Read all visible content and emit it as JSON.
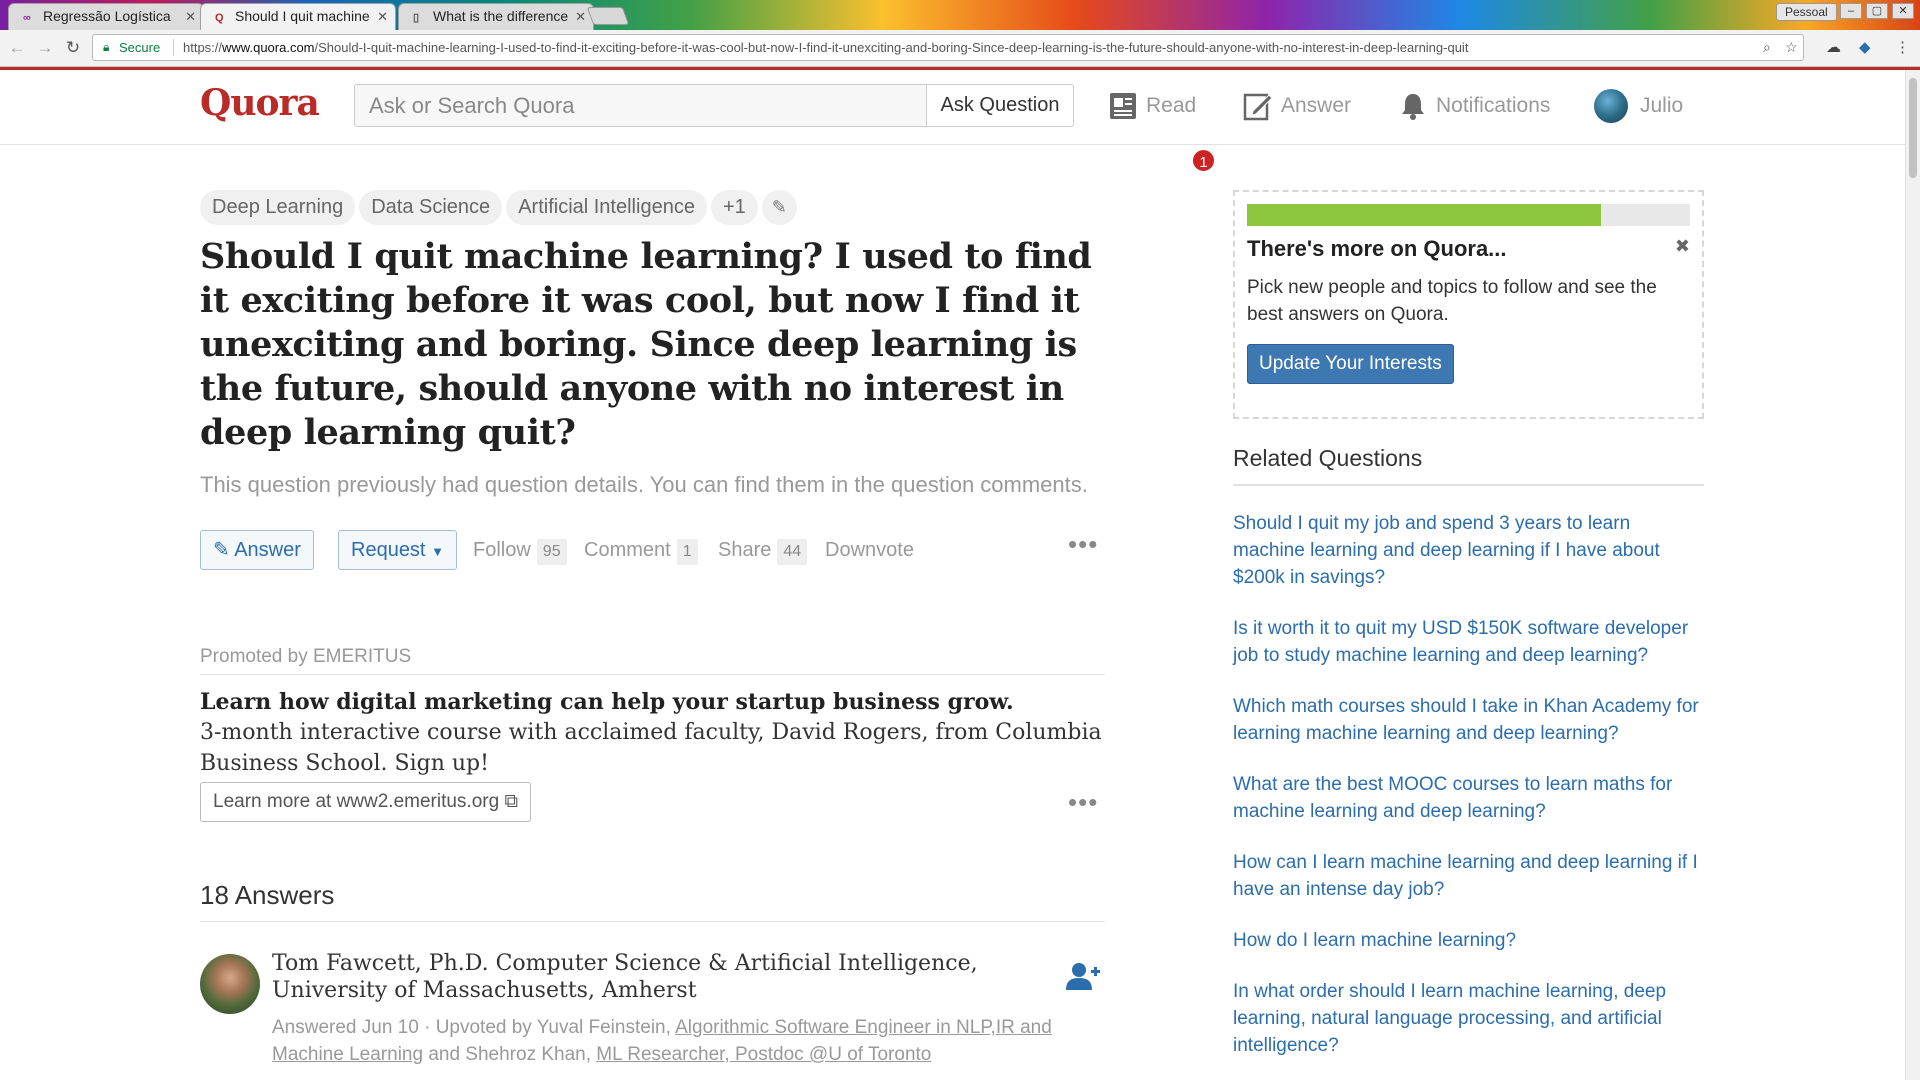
{
  "browser": {
    "tabs": [
      {
        "icon": "∞",
        "title": "Regressão Logística",
        "active": false
      },
      {
        "icon": "Q",
        "title": "Should I quit machine",
        "active": true
      },
      {
        "icon": "▯",
        "title": "What is the difference",
        "active": false
      }
    ],
    "profile": "Pessoal",
    "secure_label": "Secure",
    "url_scheme": "https://",
    "url_host": "www.quora.com",
    "url_path": "/Should-I-quit-machine-learning-I-used-to-find-it-exciting-before-it-was-cool-but-now-I-find-it-unexciting-and-boring-Since-deep-learning-is-the-future-should-anyone-with-no-interest-in-deep-learning-quit"
  },
  "header": {
    "logo": "Quora",
    "search_placeholder": "Ask or Search Quora",
    "ask_button": "Ask Question",
    "nav": {
      "read": "Read",
      "read_badge": "1",
      "answer": "Answer",
      "notifications": "Notifications",
      "user": "Julio"
    }
  },
  "question": {
    "topics": [
      "Deep Learning",
      "Data Science",
      "Artificial Intelligence",
      "+1"
    ],
    "title": "Should I quit machine learning? I used to find it exciting before it was cool, but now I find it unexciting and boring. Since deep learning is the future, should anyone with no interest in deep learning quit?",
    "note": "This question previously had question details. You can find them in the question comments.",
    "actions": {
      "answer": "Answer",
      "request": "Request",
      "follow": "Follow",
      "follow_count": "95",
      "comment": "Comment",
      "comment_count": "1",
      "share": "Share",
      "share_count": "44",
      "downvote": "Downvote"
    }
  },
  "promo": {
    "promoted_by": "Promoted by EMERITUS",
    "headline": "Learn how digital marketing can help your startup business grow.",
    "body": "3-month interactive course with acclaimed faculty, David Rogers, from Columbia Business School. Sign up!",
    "link": "Learn more at www2.emeritus.org"
  },
  "answers": {
    "heading": "18 Answers",
    "first": {
      "author": "Tom Fawcett, Ph.D. Computer Science & Artificial Intelligence, University of Massachusetts, Amherst",
      "answered": "Answered Jun 10 · Upvoted by Yuval Feinstein, ",
      "upvoter1_cred": "Algorithmic Software Engineer in NLP,IR and Machine Learning",
      "and_text": " and Shehroz Khan, ",
      "upvoter2_cred": "ML Researcher, Postdoc @U of Toronto"
    }
  },
  "sidebar": {
    "progress": 0.8,
    "more_title": "There's more on Quora...",
    "more_text": "Pick new people and topics to follow and see the best answers on Quora.",
    "update_button": "Update Your Interests",
    "related_heading": "Related Questions",
    "related": [
      "Should I quit my job and spend 3 years to learn machine learning and deep learning if I have about $200k in savings?",
      "Is it worth it to quit my USD $150K software developer job to study machine learning and deep learning?",
      "Which math courses should I take in Khan Academy for learning machine learning and deep learning?",
      "What are the best MOOC courses to learn maths for machine learning and deep learning?",
      "How can I learn machine learning and deep learning if I have an intense day job?",
      "How do I learn machine learning?",
      "In what order should I learn machine learning, deep learning, natural language processing, and artificial intelligence?"
    ]
  },
  "colors": {
    "brand": "#b92b27",
    "link": "#2b6dad",
    "progress": "#8cc63f"
  }
}
